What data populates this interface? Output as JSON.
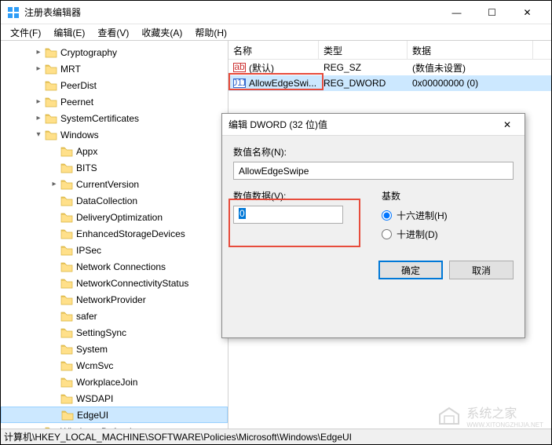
{
  "window": {
    "title": "注册表编辑器",
    "controls": {
      "min": "—",
      "max": "☐",
      "close": "✕"
    }
  },
  "menu": {
    "file": "文件(F)",
    "edit": "编辑(E)",
    "view": "查看(V)",
    "favorites": "收藏夹(A)",
    "help": "帮助(H)"
  },
  "tree": [
    {
      "indent": 40,
      "exp": ">",
      "label": "Cryptography"
    },
    {
      "indent": 40,
      "exp": ">",
      "label": "MRT"
    },
    {
      "indent": 40,
      "exp": "",
      "label": "PeerDist"
    },
    {
      "indent": 40,
      "exp": ">",
      "label": "Peernet"
    },
    {
      "indent": 40,
      "exp": ">",
      "label": "SystemCertificates"
    },
    {
      "indent": 40,
      "exp": "v",
      "label": "Windows"
    },
    {
      "indent": 60,
      "exp": "",
      "label": "Appx"
    },
    {
      "indent": 60,
      "exp": "",
      "label": "BITS"
    },
    {
      "indent": 60,
      "exp": ">",
      "label": "CurrentVersion"
    },
    {
      "indent": 60,
      "exp": "",
      "label": "DataCollection"
    },
    {
      "indent": 60,
      "exp": "",
      "label": "DeliveryOptimization"
    },
    {
      "indent": 60,
      "exp": "",
      "label": "EnhancedStorageDevices"
    },
    {
      "indent": 60,
      "exp": "",
      "label": "IPSec"
    },
    {
      "indent": 60,
      "exp": "",
      "label": "Network Connections"
    },
    {
      "indent": 60,
      "exp": "",
      "label": "NetworkConnectivityStatus"
    },
    {
      "indent": 60,
      "exp": "",
      "label": "NetworkProvider"
    },
    {
      "indent": 60,
      "exp": "",
      "label": "safer"
    },
    {
      "indent": 60,
      "exp": "",
      "label": "SettingSync"
    },
    {
      "indent": 60,
      "exp": "",
      "label": "System"
    },
    {
      "indent": 60,
      "exp": "",
      "label": "WcmSvc"
    },
    {
      "indent": 60,
      "exp": "",
      "label": "WorkplaceJoin"
    },
    {
      "indent": 60,
      "exp": "",
      "label": "WSDAPI"
    },
    {
      "indent": 60,
      "exp": "",
      "label": "EdgeUI",
      "selected": true
    },
    {
      "indent": 40,
      "exp": ">",
      "label": "Windows Defender"
    }
  ],
  "list": {
    "headers": {
      "name": "名称",
      "type": "类型",
      "data": "数据"
    },
    "colw": {
      "name": 115,
      "type": 113,
      "data": 160
    },
    "rows": [
      {
        "icon": "ab",
        "name": "(默认)",
        "type": "REG_SZ",
        "data": "(数值未设置)"
      },
      {
        "icon": "011",
        "name": "AllowEdgeSwi...",
        "type": "REG_DWORD",
        "data": "0x00000000 (0)",
        "highlighted": true
      }
    ]
  },
  "dialog": {
    "title": "编辑 DWORD (32 位)值",
    "name_label": "数值名称(N):",
    "name_value": "AllowEdgeSwipe",
    "data_label": "数值数据(V):",
    "data_value": "0",
    "base_label": "基数",
    "radio_hex": "十六进制(H)",
    "radio_dec": "十进制(D)",
    "ok": "确定",
    "cancel": "取消"
  },
  "statusbar": {
    "path": "计算机\\HKEY_LOCAL_MACHINE\\SOFTWARE\\Policies\\Microsoft\\Windows\\EdgeUI"
  },
  "watermark": {
    "text": "系统之家",
    "url": "WWW.XITONGZHIJIA.NET"
  }
}
